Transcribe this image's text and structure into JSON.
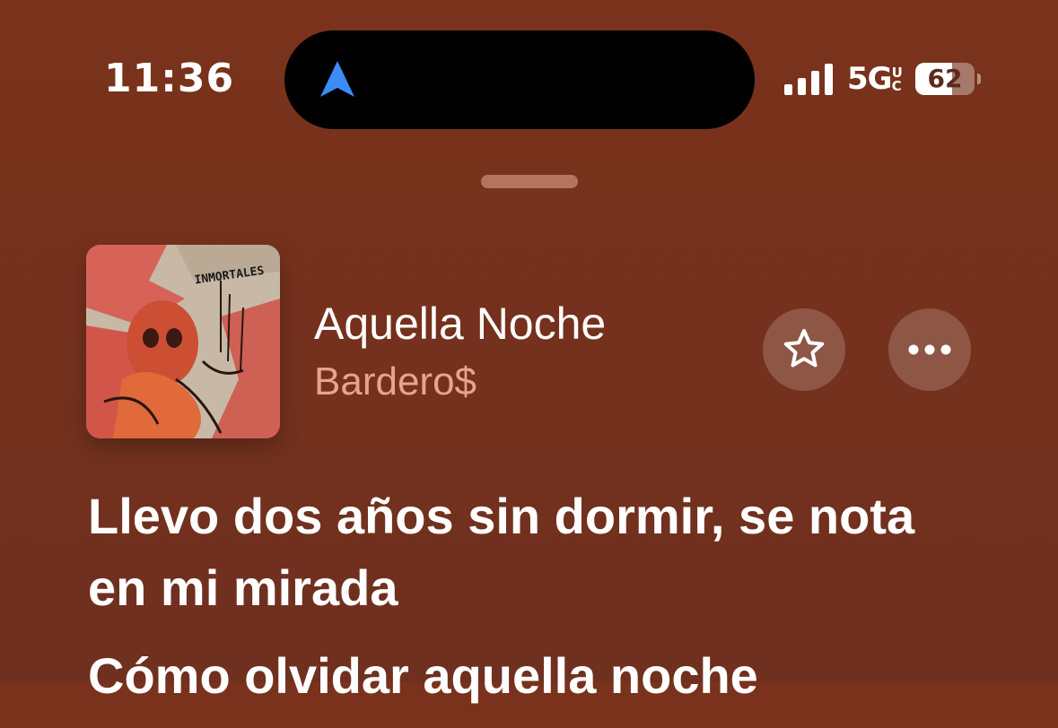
{
  "status_bar": {
    "time": "11:36",
    "network": "5G",
    "network_suffix": "UC",
    "battery_level": "62",
    "battery_fraction": 0.62
  },
  "now_playing": {
    "title": "Aquella Noche",
    "artist": "Bardero$",
    "album_art_text": "INMORTALES"
  },
  "lyrics": [
    "Llevo dos años sin dormir, se nota en mi mirada",
    "Cómo olvidar aquella noche"
  ],
  "icons": {
    "navigation": "location-arrow-icon",
    "signal": "cellular-signal-icon",
    "favorite": "star-icon",
    "more": "ellipsis-icon"
  },
  "colors": {
    "background": "#7a321c",
    "artist": "#e8a48a",
    "nav_arrow": "#3b8cf7"
  }
}
